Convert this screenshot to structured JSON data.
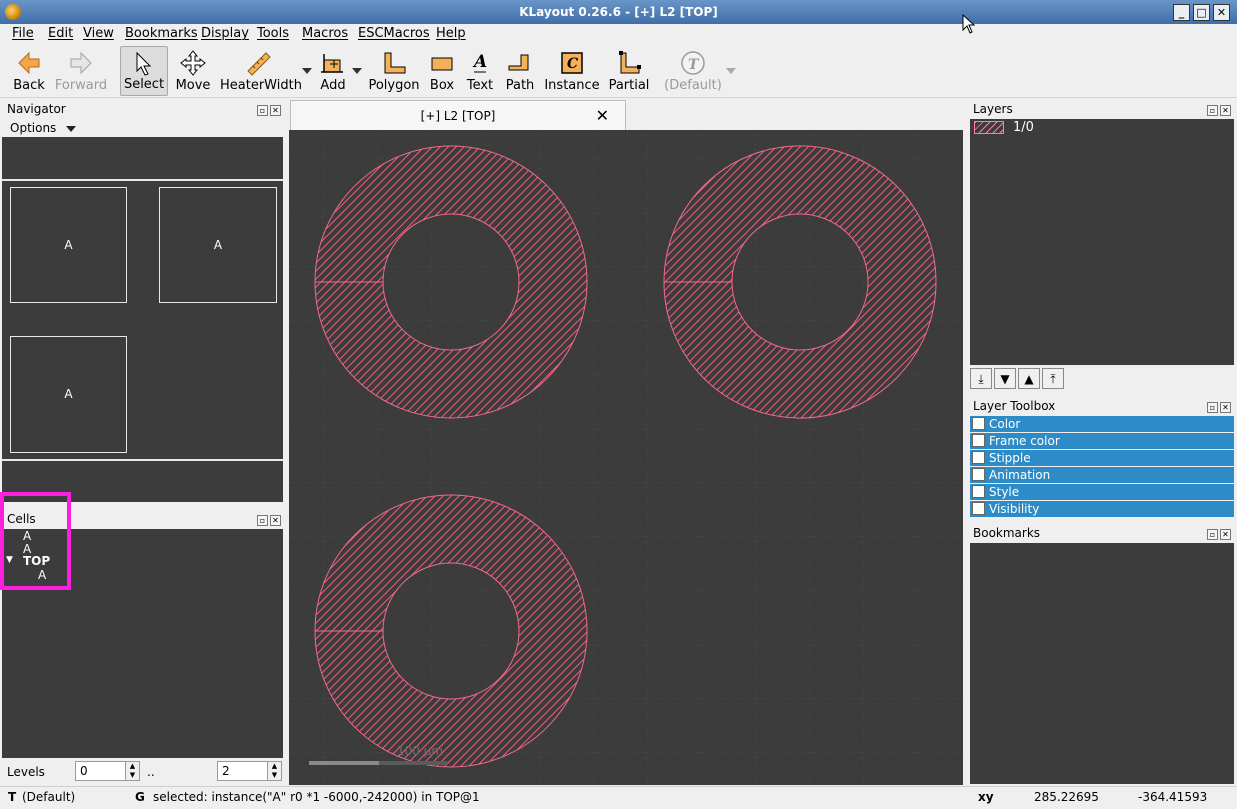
{
  "window": {
    "title": "KLayout 0.26.6 - [+] L2 [TOP]"
  },
  "menu": [
    "File",
    "Edit",
    "View",
    "Bookmarks",
    "Display",
    "Tools",
    "Macros",
    "ESCMacros",
    "Help"
  ],
  "toolbar": {
    "back": "Back",
    "forward": "Forward",
    "select": "Select",
    "move": "Move",
    "heater_width": "HeaterWidth",
    "add": "Add",
    "polygon": "Polygon",
    "box": "Box",
    "text": "Text",
    "path": "Path",
    "instance": "Instance",
    "partial": "Partial",
    "default": "(Default)"
  },
  "navigator": {
    "title": "Navigator",
    "options": "Options",
    "boxes": [
      "A",
      "A",
      "A"
    ]
  },
  "cells": {
    "title": "Cells",
    "items": [
      {
        "label": "A",
        "bold": false
      },
      {
        "label": "A",
        "bold": false
      },
      {
        "label": "TOP",
        "bold": true,
        "expanded": true
      },
      {
        "label": "A",
        "bold": false
      }
    ]
  },
  "levels": {
    "label": "Levels",
    "from": "0",
    "sep": "..",
    "to": "2"
  },
  "layout_tab": {
    "label": "[+] L2 [TOP]"
  },
  "canvas": {
    "scale_label": "100 µm",
    "shape_color": "#f06a8c",
    "background": "#3c3c3c"
  },
  "layers": {
    "title": "Layers",
    "items": [
      {
        "name": "1/0",
        "color": "#ff7fa0"
      }
    ]
  },
  "layer_toolbox": {
    "title": "Layer Toolbox",
    "items": [
      "Color",
      "Frame color",
      "Stipple",
      "Animation",
      "Style",
      "Visibility"
    ]
  },
  "bookmarks": {
    "title": "Bookmarks"
  },
  "status": {
    "mode": "T",
    "mode_value": "(Default)",
    "g": "G",
    "message": "selected: instance(\"A\" r0 *1 -6000,-242000) in TOP@1",
    "xy_label": "xy",
    "x": "285.22695",
    "y": "-364.41593"
  }
}
